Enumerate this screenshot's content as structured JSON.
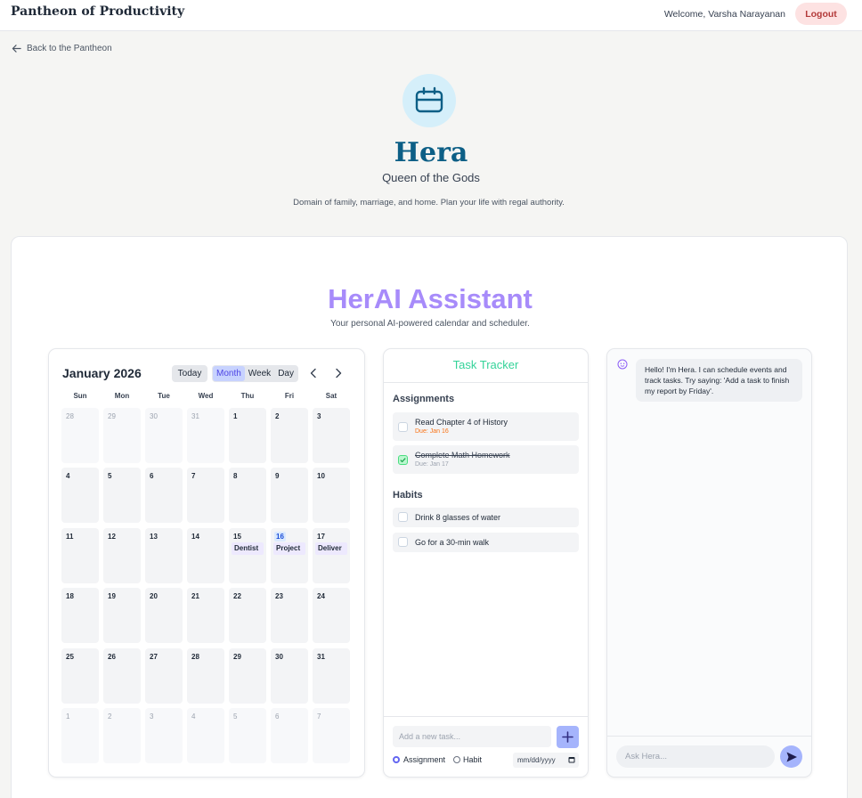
{
  "header": {
    "brand": "Pantheon of Productivity",
    "welcome": "Welcome, Varsha Narayanan",
    "logout_label": "Logout"
  },
  "back_link": "Back to the Pantheon",
  "hero": {
    "icon": "calendar-icon",
    "title": "Hera",
    "subtitle": "Queen of the Gods",
    "description": "Domain of family, marriage, and home. Plan your life with regal authority."
  },
  "assistant": {
    "title": "HerAI Assistant",
    "subtitle": "Your personal AI-powered calendar and scheduler."
  },
  "calendar": {
    "month_label": "January 2026",
    "today_label": "Today",
    "views": [
      "Month",
      "Week",
      "Day"
    ],
    "active_view": "Month",
    "weekdays": [
      "Sun",
      "Mon",
      "Tue",
      "Wed",
      "Thu",
      "Fri",
      "Sat"
    ],
    "weeks": [
      [
        {
          "d": "28",
          "o": true
        },
        {
          "d": "29",
          "o": true
        },
        {
          "d": "30",
          "o": true
        },
        {
          "d": "31",
          "o": true
        },
        {
          "d": "1"
        },
        {
          "d": "2"
        },
        {
          "d": "3"
        }
      ],
      [
        {
          "d": "4"
        },
        {
          "d": "5"
        },
        {
          "d": "6"
        },
        {
          "d": "7"
        },
        {
          "d": "8"
        },
        {
          "d": "9"
        },
        {
          "d": "10"
        }
      ],
      [
        {
          "d": "11"
        },
        {
          "d": "12"
        },
        {
          "d": "13"
        },
        {
          "d": "14"
        },
        {
          "d": "15",
          "e": "Dentist"
        },
        {
          "d": "16",
          "e": "Project",
          "t": true
        },
        {
          "d": "17",
          "e": "Deliver"
        }
      ],
      [
        {
          "d": "18"
        },
        {
          "d": "19"
        },
        {
          "d": "20"
        },
        {
          "d": "21"
        },
        {
          "d": "22"
        },
        {
          "d": "23"
        },
        {
          "d": "24"
        }
      ],
      [
        {
          "d": "25"
        },
        {
          "d": "26"
        },
        {
          "d": "27"
        },
        {
          "d": "28"
        },
        {
          "d": "29"
        },
        {
          "d": "30"
        },
        {
          "d": "31"
        }
      ],
      [
        {
          "d": "1",
          "o": true
        },
        {
          "d": "2",
          "o": true
        },
        {
          "d": "3",
          "o": true
        },
        {
          "d": "4",
          "o": true
        },
        {
          "d": "5",
          "o": true
        },
        {
          "d": "6",
          "o": true
        },
        {
          "d": "7",
          "o": true
        }
      ]
    ]
  },
  "tasks": {
    "title": "Task Tracker",
    "assignments_heading": "Assignments",
    "assignments": [
      {
        "title": "Read Chapter 4 of History",
        "due": "Due: Jan 16",
        "done": false,
        "due_color": "#f97316"
      },
      {
        "title": "Complete Math Homework",
        "due": "Due: Jan 17",
        "done": true,
        "due_color": "#9ca3af"
      }
    ],
    "habits_heading": "Habits",
    "habits": [
      {
        "title": "Drink 8 glasses of water",
        "done": false
      },
      {
        "title": "Go for a 30-min walk",
        "done": false
      }
    ],
    "add_placeholder": "Add a new task...",
    "type_assignment": "Assignment",
    "type_habit": "Habit",
    "date_placeholder": "mm/dd/yyyy"
  },
  "chat": {
    "greeting": "Hello! I'm Hera. I can schedule events and track tasks. Try saying: 'Add a task to finish my report by Friday'.",
    "input_placeholder": "Ask Hera..."
  }
}
